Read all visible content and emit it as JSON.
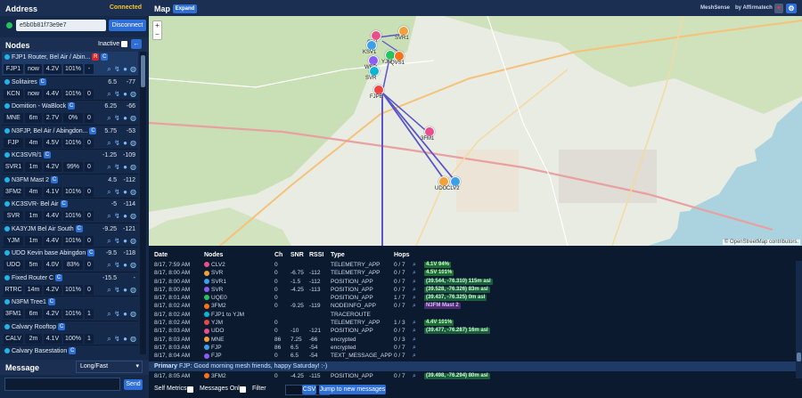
{
  "sidebar": {
    "address_title": "Address",
    "status": "Connected",
    "address_value": "e5b0b81f73e9e7",
    "disconnect_label": "Disconnect",
    "nodes_title": "Nodes",
    "inactive_label": "Inactive",
    "message_title": "Message",
    "preset": "Long/Fast",
    "send_label": "Send",
    "nodes": [
      {
        "name": "FJP1 Router, Bel Air / Abin...",
        "badges": [
          "R",
          "C"
        ],
        "v1": "",
        "v2": "",
        "short": "FJP1",
        "age": "now",
        "volt": "4.2V",
        "batt": "101%",
        "hops": "-"
      },
      {
        "name": "Solitaires",
        "badges": [
          "C"
        ],
        "v1": "6.5",
        "v2": "-77",
        "short": "KCN",
        "age": "now",
        "volt": "4.4V",
        "batt": "101%",
        "hops": "0"
      },
      {
        "name": "Domition - WaBlock",
        "badges": [
          "C"
        ],
        "v1": "6.25",
        "v2": "-66",
        "short": "MNE",
        "age": "6m",
        "volt": "2.7V",
        "batt": "0%",
        "hops": "0"
      },
      {
        "name": "N3FJP, Bel Air / Abingdon...",
        "badges": [
          "C"
        ],
        "v1": "5.75",
        "v2": "-53",
        "short": "FJP",
        "age": "4m",
        "volt": "4.5V",
        "batt": "101%",
        "hops": "0"
      },
      {
        "name": "KC3SVR/1",
        "badges": [
          "C"
        ],
        "v1": "-1.25",
        "v2": "-109",
        "short": "SVR1",
        "age": "1m",
        "volt": "4.2V",
        "batt": "99%",
        "hops": "0"
      },
      {
        "name": "N3FM Mast 2",
        "badges": [
          "C"
        ],
        "v1": "4.5",
        "v2": "-112",
        "short": "3FM2",
        "age": "4m",
        "volt": "4.1V",
        "batt": "101%",
        "hops": "0"
      },
      {
        "name": "KC3SVR- Bel Air",
        "badges": [
          "C"
        ],
        "v1": "-5",
        "v2": "-114",
        "short": "SVR",
        "age": "1m",
        "volt": "4.4V",
        "batt": "101%",
        "hops": "0"
      },
      {
        "name": "KA3YJM Bel Air South",
        "badges": [
          "C"
        ],
        "v1": "-9.25",
        "v2": "-121",
        "short": "YJM",
        "age": "1m",
        "volt": "4.4V",
        "batt": "101%",
        "hops": "0"
      },
      {
        "name": "UDO Kevin base Abingdon",
        "badges": [
          "C"
        ],
        "v1": "-9.5",
        "v2": "-118",
        "short": "UDO",
        "age": "5m",
        "volt": "4.0V",
        "batt": "83%",
        "hops": "0"
      },
      {
        "name": "Fixed Router C",
        "badges": [
          "C"
        ],
        "v1": "-15.5",
        "v2": "-",
        "short": "RTRC",
        "age": "14m",
        "volt": "4.2V",
        "batt": "101%",
        "hops": "0"
      },
      {
        "name": "N3FM Tree1",
        "badges": [
          "C"
        ],
        "v1": "",
        "v2": "",
        "short": "3FM1",
        "age": "6m",
        "volt": "4.2V",
        "batt": "101%",
        "hops": "1"
      },
      {
        "name": "Calvary Rooftop",
        "badges": [
          "C"
        ],
        "v1": "",
        "v2": "",
        "short": "CALV",
        "age": "2m",
        "volt": "4.1V",
        "batt": "100%",
        "hops": "1"
      },
      {
        "name": "Calvary Basestation",
        "badges": [
          "C"
        ],
        "v1": "",
        "v2": "",
        "short": "",
        "age": "",
        "volt": "",
        "batt": "",
        "hops": ""
      }
    ]
  },
  "map": {
    "title": "Map",
    "expand_label": "Expand",
    "brand": "MeshSense",
    "by": "by Affirmatech",
    "attribution": "© OpenStreetMap contributors.",
    "markers": [
      "CLV",
      "SVR1",
      "KSV1",
      "WBR",
      "YJM",
      "QVS1",
      "SVR",
      "FJPE",
      "3FM1",
      "UDO",
      "CLV2"
    ]
  },
  "table": {
    "headers": {
      "date": "Date",
      "nodes": "Nodes",
      "ch": "Ch",
      "snr": "SNR",
      "rssi": "RSSI",
      "type": "Type",
      "hops": "Hops"
    },
    "rows": [
      {
        "date": "8/17, 7:59 AM",
        "node": "CLV2",
        "ch": "0",
        "snr": "",
        "rssi": "",
        "type": "TELEMETRY_APP",
        "hops": "0 / 7",
        "info": "4.1V 94%",
        "info_type": "telemetry"
      },
      {
        "date": "8/17, 8:00 AM",
        "node": "SVR",
        "ch": "0",
        "snr": "-6.75",
        "rssi": "-112",
        "type": "TELEMETRY_APP",
        "hops": "0 / 7",
        "info": "4.5V 101%",
        "info_type": "telemetry"
      },
      {
        "date": "8/17, 8:00 AM",
        "node": "SVR1",
        "ch": "0",
        "snr": "-1.5",
        "rssi": "-112",
        "type": "POSITION_APP",
        "hops": "0 / 7",
        "info": "(39.544, -76.310) 115m asl",
        "info_type": "position"
      },
      {
        "date": "8/17, 8:00 AM",
        "node": "SVR",
        "ch": "0",
        "snr": "-4.25",
        "rssi": "-113",
        "type": "POSITION_APP",
        "hops": "0 / 7",
        "info": "(39.528, -76.326) 83m asl",
        "info_type": "position"
      },
      {
        "date": "8/17, 8:01 AM",
        "node": "UQE0",
        "ch": "0",
        "snr": "",
        "rssi": "",
        "type": "POSITION_APP",
        "hops": "1 / 7",
        "info": "(39.437, -76.325) 0m asl",
        "info_type": "position"
      },
      {
        "date": "8/17, 8:02 AM",
        "node": "3FM2",
        "ch": "0",
        "snr": "-9.25",
        "rssi": "-119",
        "type": "NODEINFO_APP",
        "hops": "0 / 7",
        "info": "N3FM Mast 2",
        "info_type": "nodeinfo"
      },
      {
        "date": "8/17, 8:02 AM",
        "node": "FJP1 to YJM",
        "ch": "",
        "snr": "",
        "rssi": "",
        "type": "TRACEROUTE",
        "hops": "",
        "info": "",
        "info_type": ""
      },
      {
        "date": "8/17, 8:02 AM",
        "node": "YJM",
        "ch": "0",
        "snr": "",
        "rssi": "",
        "type": "TELEMETRY_APP",
        "hops": "1 / 3",
        "info": "4.4V 101%",
        "info_type": "telemetry"
      },
      {
        "date": "8/17, 8:03 AM",
        "node": "UDO",
        "ch": "0",
        "snr": "-10",
        "rssi": "-121",
        "type": "POSITION_APP",
        "hops": "0 / 7",
        "info": "(39.477, -76.287) 16m asl",
        "info_type": "position"
      },
      {
        "date": "8/17, 8:03 AM",
        "node": "MNE",
        "ch": "86",
        "snr": "7.25",
        "rssi": "-66",
        "type": "encrypted",
        "hops": "0 / 3",
        "info": "",
        "info_type": ""
      },
      {
        "date": "8/17, 8:03 AM",
        "node": "FJP",
        "ch": "86",
        "snr": "6.5",
        "rssi": "-54",
        "type": "encrypted",
        "hops": "0 / 7",
        "info": "",
        "info_type": ""
      },
      {
        "date": "8/17, 8:04 AM",
        "node": "FJP",
        "ch": "0",
        "snr": "6.5",
        "rssi": "-54",
        "type": "TEXT_MESSAGE_APP",
        "hops": "0 / 7",
        "info": "",
        "info_type": ""
      }
    ],
    "primary_label": "Primary",
    "primary_text": "FJP: Good morning mesh friends, happy Saturday! :-)",
    "last_row": {
      "date": "8/17, 8:05 AM",
      "node": "3FM2",
      "ch": "0",
      "snr": "-4.25",
      "rssi": "-115",
      "type": "POSITION_APP",
      "hops": "0 / 7",
      "info": "(39.498, -76.294) 80m asl",
      "info_type": "position"
    }
  },
  "footer": {
    "self_metrics": "Self Metrics",
    "messages_only": "Messages Only",
    "filter": "Filter",
    "csv": "CSV",
    "jump": "Jump to new messages"
  },
  "colors": {
    "accent": "#2d6fd6",
    "connected": "#f4c431",
    "telemetry_bg": "#1f6b34",
    "position_bg": "#1b5c3c",
    "nodeinfo_bg": "#4a2d6b"
  }
}
